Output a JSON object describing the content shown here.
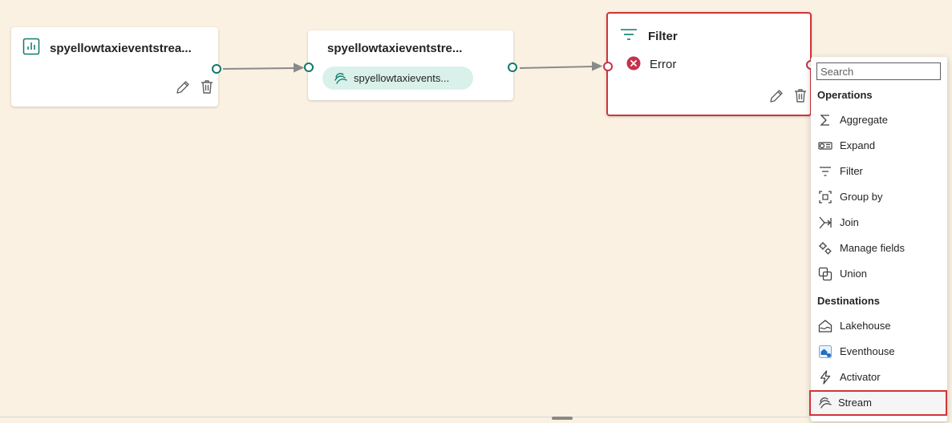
{
  "canvas": {
    "nodes": {
      "source": {
        "title": "spyellowtaxieventstrea..."
      },
      "stream": {
        "title": "spyellowtaxieventstre...",
        "chip": "spyellowtaxievents..."
      },
      "filter": {
        "title": "Filter",
        "status": "Error"
      }
    }
  },
  "menu": {
    "search_placeholder": "Search",
    "operations_header": "Operations",
    "operations": [
      {
        "label": "Aggregate",
        "icon": "sigma-icon"
      },
      {
        "label": "Expand",
        "icon": "expand-icon"
      },
      {
        "label": "Filter",
        "icon": "filter-icon"
      },
      {
        "label": "Group by",
        "icon": "group-by-icon"
      },
      {
        "label": "Join",
        "icon": "join-icon"
      },
      {
        "label": "Manage fields",
        "icon": "gears-icon"
      },
      {
        "label": "Union",
        "icon": "union-icon"
      }
    ],
    "destinations_header": "Destinations",
    "destinations": [
      {
        "label": "Lakehouse",
        "icon": "lakehouse-icon"
      },
      {
        "label": "Eventhouse",
        "icon": "eventhouse-icon"
      },
      {
        "label": "Activator",
        "icon": "lightning-icon"
      },
      {
        "label": "Stream",
        "icon": "stream-icon"
      }
    ]
  },
  "colors": {
    "canvas_bg": "#faf1e2",
    "accent_teal": "#0e7a6a",
    "error_red": "#c4314b",
    "highlight_border": "#d13438",
    "chip_bg": "#d9f1ea"
  }
}
